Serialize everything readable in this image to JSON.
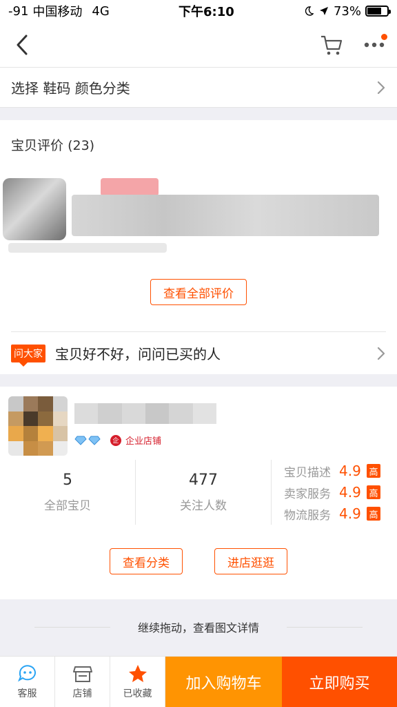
{
  "status_bar": {
    "signal": "-91",
    "carrier": "中国移动",
    "network": "4G",
    "time": "下午6:10",
    "battery": "73%",
    "battery_level": 0.73
  },
  "nav": {
    "back_icon": "chevron-left-icon",
    "cart_icon": "cart-icon",
    "more_icon": "more-icon"
  },
  "select": {
    "label": "选择 鞋码 颜色分类"
  },
  "reviews": {
    "title": "宝贝评价",
    "count": "(23)",
    "see_all": "查看全部评价"
  },
  "ask": {
    "badge": "问大家",
    "text": "宝贝好不好，问问已买的人"
  },
  "shop": {
    "badge": "企业店铺",
    "stats": [
      {
        "value": "5",
        "label": "全部宝贝"
      },
      {
        "value": "477",
        "label": "关注人数"
      }
    ],
    "ratings": [
      {
        "label": "宝贝描述",
        "score": "4.9",
        "tag": "高"
      },
      {
        "label": "卖家服务",
        "score": "4.9",
        "tag": "高"
      },
      {
        "label": "物流服务",
        "score": "4.9",
        "tag": "高"
      }
    ],
    "btn_category": "查看分类",
    "btn_enter": "进店逛逛"
  },
  "continue_text": "继续拖动，查看图文详情",
  "bottom": {
    "service": "客服",
    "store": "店铺",
    "favorited": "已收藏",
    "add_cart": "加入购物车",
    "buy_now": "立即购买"
  },
  "colors": {
    "accent": "#ff5000",
    "cart": "#ff9402"
  }
}
